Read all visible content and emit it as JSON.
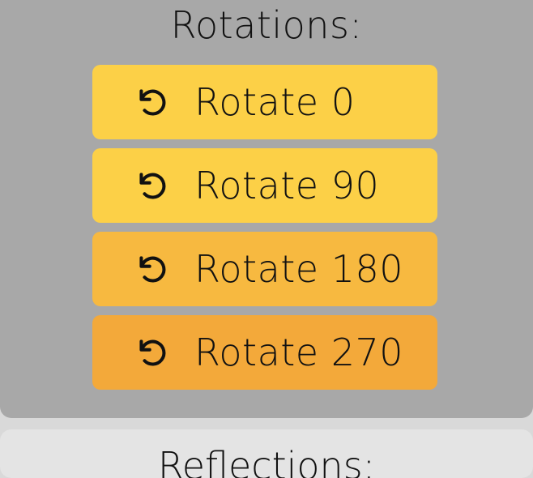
{
  "rotations": {
    "title": "Rotations:",
    "buttons": [
      {
        "label": "Rotate 0",
        "icon": "rotate-ccw-icon",
        "color": "#fcd047"
      },
      {
        "label": "Rotate 90",
        "icon": "rotate-ccw-icon",
        "color": "#fcd047"
      },
      {
        "label": "Rotate 180",
        "icon": "rotate-ccw-icon",
        "color": "#f7b940"
      },
      {
        "label": "Rotate 270",
        "icon": "rotate-ccw-icon",
        "color": "#f3a93a"
      }
    ]
  },
  "reflections": {
    "title": "Reflections:"
  }
}
